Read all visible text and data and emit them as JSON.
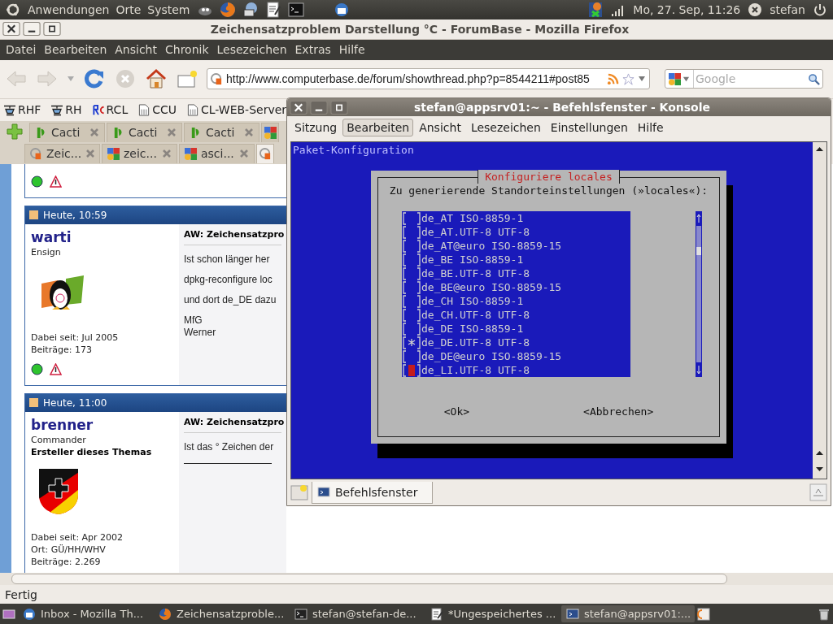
{
  "top_panel": {
    "menus": [
      "Anwendungen",
      "Orte",
      "System"
    ],
    "clock": "Mo, 27. Sep, 11:26",
    "user": "stefan"
  },
  "firefox": {
    "title": "Zeichensatzproblem Darstellung °C - ForumBase - Mozilla Firefox",
    "menu": [
      "Datei",
      "Bearbeiten",
      "Ansicht",
      "Chronik",
      "Lesezeichen",
      "Extras",
      "Hilfe"
    ],
    "url": "http://www.computerbase.de/forum/showthread.php?p=8544211#post85",
    "search": {
      "placeholder": "Google"
    },
    "bookmarks": [
      {
        "label": "RHF",
        "kind": "heli"
      },
      {
        "label": "RH",
        "kind": "heli"
      },
      {
        "label": "RCL",
        "kind": "rc"
      },
      {
        "label": "CCU",
        "kind": "page"
      },
      {
        "label": "CL-WEB-Server",
        "kind": "page"
      }
    ],
    "tabs_row1": [
      {
        "label": "Cacti",
        "kind": "cacti",
        "selected": false
      },
      {
        "label": "Cacti",
        "kind": "cacti",
        "selected": false
      },
      {
        "label": "Cacti",
        "kind": "cacti",
        "selected": false
      },
      {
        "kind": "google",
        "selected": false
      }
    ],
    "tabs_row2": [
      {
        "label": "Zeic...",
        "kind": "cb",
        "selected": false
      },
      {
        "label": "zeic...",
        "kind": "google",
        "selected": false
      },
      {
        "label": "asci...",
        "kind": "google",
        "selected": false
      },
      {
        "kind": "cb",
        "selected": true
      }
    ],
    "posts": [
      {
        "kind": "cut_off"
      },
      {
        "time": "Heute, 10:59",
        "user": "warti",
        "kind": "full",
        "rank": "Ensign",
        "avatar": {
          "kind": "penguin"
        },
        "info": [
          "Dabei seit: Jul 2005",
          "Beiträge: 173"
        ],
        "title": "AW: Zeichensatzpro",
        "lines": [
          "Ist schon länger her",
          "dpkg-reconfigure loc",
          "und dort de_DE dazu",
          "MfG\nWerner"
        ]
      },
      {
        "time": "Heute, 11:00",
        "user": "brenner",
        "rank": "Commander",
        "kind": "full",
        "starter": "Ersteller dieses Themas",
        "avatar": {
          "kind": "shield"
        },
        "info": [
          "Dabei seit: Apr 2002",
          "Ort: GÜ/HH/WHV",
          "Beiträge: 2.269"
        ],
        "title": "AW: Zeichensatzpro",
        "lines": [
          "Ist das ° Zeichen der"
        ],
        "signature_rule": true
      }
    ],
    "status": "Fertig"
  },
  "konsole": {
    "title": "stefan@appsrv01:~ - Befehlsfenster - Konsole",
    "menu": [
      {
        "label": "Sitzung",
        "hovered": false
      },
      {
        "label": "Bearbeiten",
        "hovered": true
      },
      {
        "label": "Ansicht",
        "hovered": false
      },
      {
        "label": "Lesezeichen",
        "hovered": false
      },
      {
        "label": "Einstellungen",
        "hovered": false
      },
      {
        "label": "Hilfe",
        "hovered": false
      }
    ],
    "terminal": {
      "header": "Paket-Konfiguration",
      "dialog_title": "Konfiguriere locales",
      "prompt": "Zu generierende Standorteinstellungen (»locales«):",
      "items": [
        {
          "label": "de_AT ISO-8859-1",
          "checked": false,
          "cursor": false
        },
        {
          "label": "de_AT.UTF-8 UTF-8",
          "checked": false,
          "cursor": false
        },
        {
          "label": "de_AT@euro ISO-8859-15",
          "checked": false,
          "cursor": false
        },
        {
          "label": "de_BE ISO-8859-1",
          "checked": false,
          "cursor": false
        },
        {
          "label": "de_BE.UTF-8 UTF-8",
          "checked": false,
          "cursor": false
        },
        {
          "label": "de_BE@euro ISO-8859-15",
          "checked": false,
          "cursor": false
        },
        {
          "label": "de_CH ISO-8859-1",
          "checked": false,
          "cursor": false
        },
        {
          "label": "de_CH.UTF-8 UTF-8",
          "checked": false,
          "cursor": false
        },
        {
          "label": "de_DE ISO-8859-1",
          "checked": false,
          "cursor": false
        },
        {
          "label": "de_DE.UTF-8 UTF-8",
          "checked": true,
          "cursor": false
        },
        {
          "label": "de_DE@euro ISO-8859-15",
          "checked": false,
          "cursor": false
        },
        {
          "label": "de_LI.UTF-8 UTF-8",
          "checked": false,
          "cursor": true
        }
      ],
      "buttons": [
        "<Ok>",
        "<Abbrechen>"
      ]
    },
    "tabs": [
      {
        "label": "Befehlsfenster",
        "selected": true
      }
    ]
  },
  "taskbar": [
    {
      "label": "Inbox - Mozilla Th...",
      "kind": "mail",
      "selected": false
    },
    {
      "label": "Zeichensatzproble...",
      "kind": "browser",
      "selected": false
    },
    {
      "label": "stefan@stefan-de...",
      "kind": "terminal",
      "selected": false
    },
    {
      "label": "*Ungespeichertes ...",
      "kind": "editor",
      "selected": false
    },
    {
      "label": "stefan@appsrv01:...",
      "kind": "konsole",
      "selected": true
    }
  ]
}
